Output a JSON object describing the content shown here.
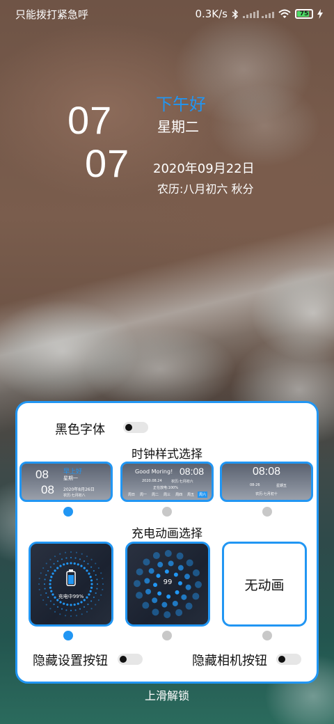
{
  "status_bar": {
    "carrier_text": "只能拨打紧急呼",
    "net_speed": "0.3K/s",
    "battery_level": "75",
    "battery_color": "#4cd964"
  },
  "lockscreen": {
    "hour": "07",
    "minute": "07",
    "greeting": "下午好",
    "weekday": "星期二",
    "date": "2020年09月22日",
    "lunar": "农历:八月初六 秋分",
    "accent_color": "#2196f3"
  },
  "settings_panel": {
    "black_font_label": "黑色字体",
    "clock_style_title": "时钟样式选择",
    "clock_styles": [
      {
        "hour": "08",
        "minute": "08",
        "greeting": "早上好",
        "weekday": "星期一",
        "date": "2020年8月26日",
        "lunar": "农历:七月初八",
        "selected": true
      },
      {
        "greeting": "Good Moring!",
        "time": "08:08",
        "date": "2020.08.24",
        "lunar": "农历:七月初六",
        "battery": "正在放电:100%",
        "days": [
          "周日",
          "周一",
          "周二",
          "周三",
          "周四",
          "周五",
          "周六"
        ],
        "selected": false
      },
      {
        "time": "08:08",
        "date": "08-26",
        "weekday": "星期五",
        "lunar": "农历:七月初十",
        "selected": false
      }
    ],
    "charge_anim_title": "充电动画选择",
    "charge_anims": [
      {
        "label": "充电中99%",
        "selected": true
      },
      {
        "label": "99",
        "selected": false
      },
      {
        "label": "无动画",
        "selected": false
      }
    ],
    "hide_settings_label": "隐藏设置按钮",
    "hide_camera_label": "隐藏相机按钮"
  },
  "unlock_hint": "上滑解锁",
  "icons": [
    "bluetooth-icon",
    "signal-icon",
    "wifi-icon",
    "battery-icon",
    "charging-bolt-icon",
    "battery-glyph-icon"
  ]
}
